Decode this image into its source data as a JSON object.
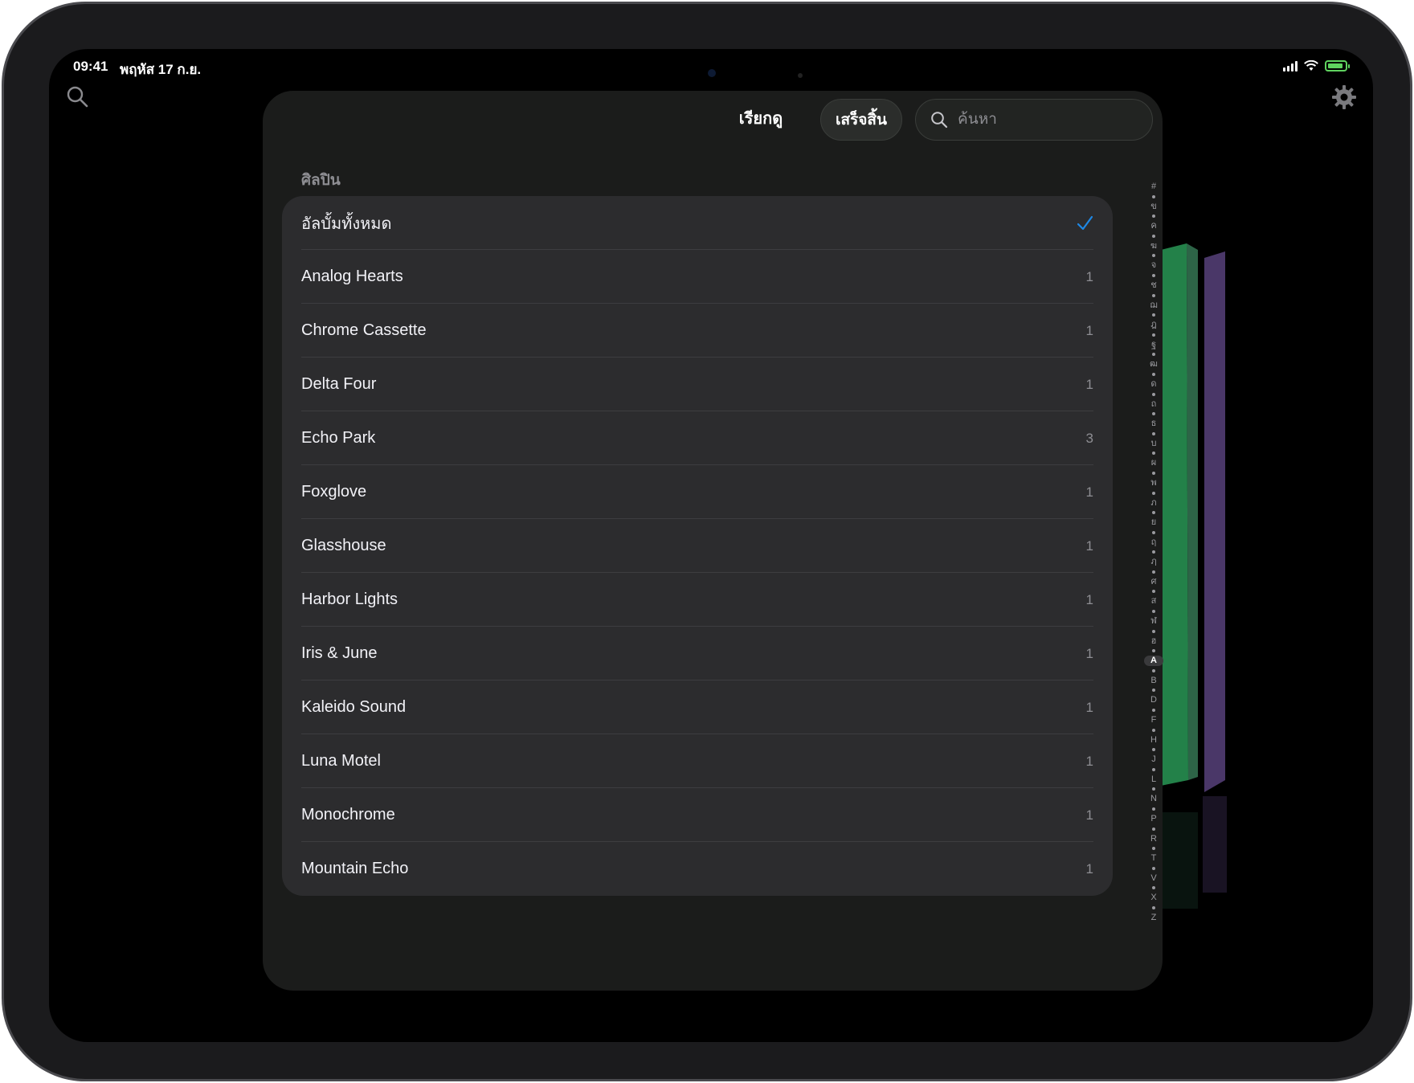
{
  "status": {
    "time": "09:41",
    "date": "พฤหัส 17 ก.ย."
  },
  "sheet": {
    "title": "เรียกดู",
    "done_label": "เสร็จสิ้น",
    "search_placeholder": "ค้นหา",
    "section_header": "ศิลปิน"
  },
  "rows": [
    {
      "label": "อัลบั้มทั้งหมด",
      "count": "",
      "selected": true
    },
    {
      "label": "Analog Hearts",
      "count": "1"
    },
    {
      "label": "Chrome Cassette",
      "count": "1"
    },
    {
      "label": "Delta Four",
      "count": "1"
    },
    {
      "label": "Echo Park",
      "count": "3"
    },
    {
      "label": "Foxglove",
      "count": "1"
    },
    {
      "label": "Glasshouse",
      "count": "1"
    },
    {
      "label": "Harbor Lights",
      "count": "1"
    },
    {
      "label": "Iris & June",
      "count": "1"
    },
    {
      "label": "Kaleido Sound",
      "count": "1"
    },
    {
      "label": "Luna Motel",
      "count": "1"
    },
    {
      "label": "Monochrome",
      "count": "1"
    },
    {
      "label": "Mountain Echo",
      "count": "1"
    }
  ],
  "index": [
    "#",
    "ข",
    "ค",
    "ฆ",
    "จ",
    "ช",
    "ฌ",
    "ฎ",
    "ฐ",
    "ฒ",
    "ด",
    "ถ",
    "ธ",
    "บ",
    "ผ",
    "พ",
    "ภ",
    "ย",
    "ฤ",
    "ฦ",
    "ศ",
    "ส",
    "ฬ",
    "ฮ",
    "A",
    "B",
    "D",
    "F",
    "H",
    "J",
    "L",
    "N",
    "P",
    "R",
    "T",
    "V",
    "X",
    "Z"
  ],
  "index_active": "A",
  "colors": {
    "accent": "#1e88e5",
    "sheet_bg": "#1b1c1b",
    "row_bg": "#2c2c2e",
    "battery": "#5fd35f"
  },
  "icons": {
    "top_left": "search-icon",
    "top_right": "gear-icon",
    "selected_mark": "check-icon"
  }
}
